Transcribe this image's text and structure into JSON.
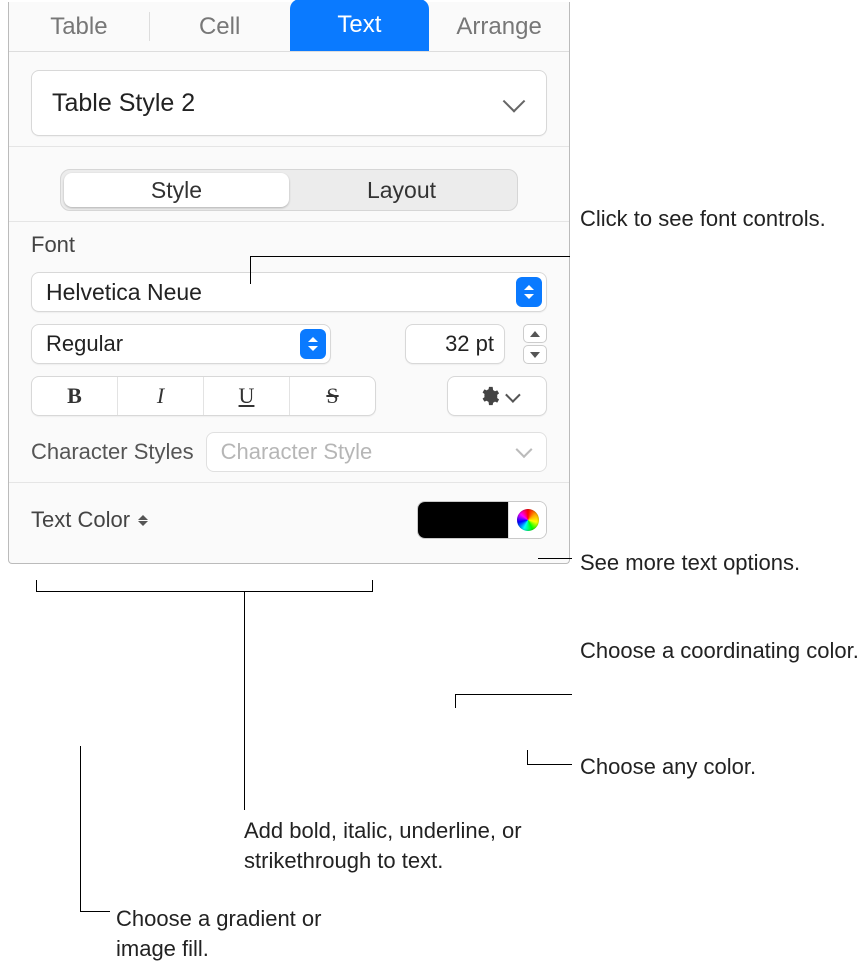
{
  "tabs": {
    "table": "Table",
    "cell": "Cell",
    "text": "Text",
    "arrange": "Arrange"
  },
  "style_name": "Table Style 2",
  "seg": {
    "style": "Style",
    "layout": "Layout"
  },
  "font_section_label": "Font",
  "font_family": "Helvetica Neue",
  "font_style": "Regular",
  "font_size": "32 pt",
  "char_styles_label": "Character Styles",
  "char_style_placeholder": "Character Style",
  "text_color_label": "Text Color",
  "callouts": {
    "style_hint": "Click to see font controls.",
    "gear_hint": "See more text options.",
    "coord_color": "Choose a coordinating color.",
    "any_color": "Choose any color.",
    "bius_hint": "Add bold, italic, underline, or strikethrough to text.",
    "textcolor_hint": "Choose a gradient or image fill."
  }
}
